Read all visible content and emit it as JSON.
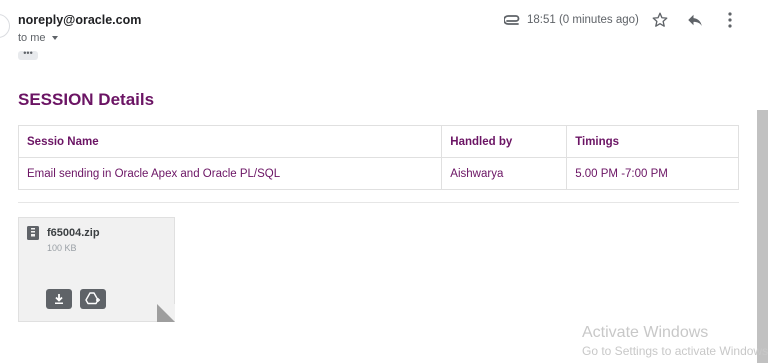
{
  "email": {
    "sender": "noreply@oracle.com",
    "recipient": "to me",
    "timestamp": "18:51 (0 minutes ago)",
    "ellipsis": "•••"
  },
  "content": {
    "title": "SESSION Details",
    "table": {
      "headers": [
        "Sessio Name",
        "Handled by",
        "Timings"
      ],
      "rows": [
        [
          "Email sending in Oracle Apex and Oracle PL/SQL",
          "Aishwarya",
          "5.00 PM -7:00 PM"
        ]
      ]
    }
  },
  "attachment": {
    "name": "f65004.zip",
    "size": "100 KB"
  },
  "watermark": {
    "line1": "Activate Windows",
    "line2": "Go to Settings to activate Windows"
  },
  "icons": {
    "attachment": "paperclip-icon",
    "star": "star-icon",
    "reply": "reply-icon",
    "more": "more-vert-icon",
    "zip": "zip-file-icon",
    "download": "download-icon",
    "drive": "add-to-drive-icon"
  },
  "colors": {
    "accent": "#6b1464",
    "icon_gray": "#5f6368"
  }
}
